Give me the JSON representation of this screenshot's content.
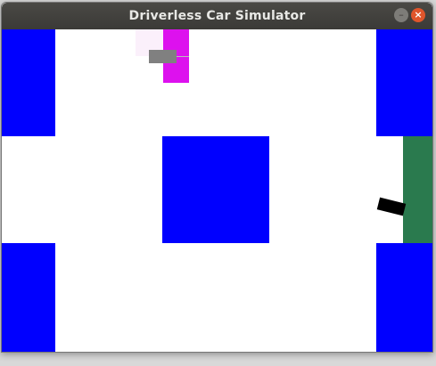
{
  "window": {
    "title": "Driverless Car Simulator",
    "minimize_glyph": "–",
    "close_glyph": "×"
  },
  "colors": {
    "block": "#0000ff",
    "goal": "#2a7a4e",
    "agent": "#dd11ee",
    "sensor": "#808080",
    "obstacle": "#000000",
    "road": "#ffffff"
  },
  "icons": {
    "minimize": "minimize-icon",
    "close": "close-icon"
  }
}
